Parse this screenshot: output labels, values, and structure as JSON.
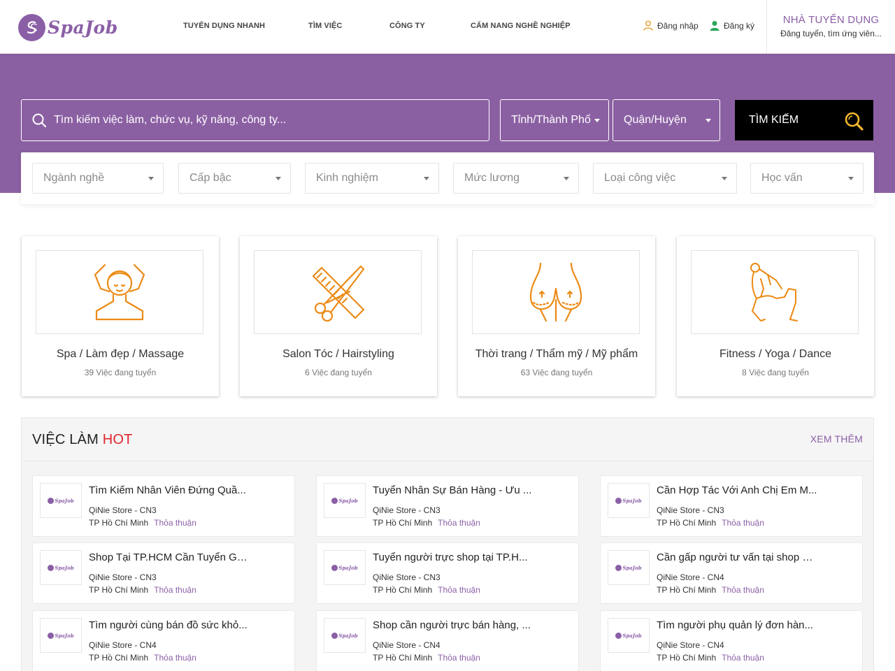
{
  "brand": {
    "name": "SpaJob",
    "accent": "#8b5fa6",
    "hero_bg": "#8b60a3"
  },
  "nav": [
    {
      "label": "TUYỂN DỤNG NHANH"
    },
    {
      "label": "TÌM VIỆC"
    },
    {
      "label": "CÔNG TY"
    },
    {
      "label": "CẨM NANG NGHỀ NGHIỆP"
    }
  ],
  "auth": {
    "login": "Đăng nhập",
    "register": "Đăng ký"
  },
  "employer": {
    "title": "NHÀ TUYỂN DỤNG",
    "subtitle": "Đăng tuyển, tìm ứng viên..."
  },
  "search": {
    "placeholder": "Tìm kiếm việc làm, chức vụ, kỹ năng, công ty...",
    "city": "Tỉnh/Thành Phố",
    "district": "Quận/Huyện",
    "button": "TÌM KIẾM"
  },
  "filters": [
    {
      "label": "Ngành nghề"
    },
    {
      "label": "Cấp bậc"
    },
    {
      "label": "Kinh nghiệm"
    },
    {
      "label": "Mức lương"
    },
    {
      "label": "Loại công việc"
    },
    {
      "label": "Học vấn"
    }
  ],
  "categories": [
    {
      "name": "Spa / Làm đẹp / Massage",
      "count": "39 Việc đang tuyển",
      "icon": "massage-icon"
    },
    {
      "name": "Salon Tóc / Hairstyling",
      "count": "6 Việc đang tuyển",
      "icon": "scissors-comb-icon"
    },
    {
      "name": "Thời trang / Thẩm mỹ / Mỹ phẩm",
      "count": "63 Việc đang tuyển",
      "icon": "body-contour-icon"
    },
    {
      "name": "Fitness / Yoga / Dance",
      "count": "8 Việc đang tuyển",
      "icon": "yoga-icon"
    }
  ],
  "hot": {
    "title_prefix": "VIỆC LÀM",
    "title_highlight": "HOT",
    "more": "XEM THÊM",
    "logo_text": "SpaJob",
    "jobs": [
      {
        "title": "Tìm Kiếm Nhân Viên Đứng Quầ...",
        "company": "QiNie Store - CN3",
        "location": "TP Hồ Chí Minh",
        "salary": "Thỏa thuận"
      },
      {
        "title": "Tuyển Nhân Sự Bán Hàng - Ưu ...",
        "company": "QiNie Store - CN3",
        "location": "TP Hồ Chí Minh",
        "salary": "Thỏa thuận"
      },
      {
        "title": "Cần Hợp Tác Với Anh Chị Em M...",
        "company": "QiNie Store - CN3",
        "location": "TP Hồ Chí Minh",
        "salary": "Thỏa thuận"
      },
      {
        "title": "Shop Tại TP.HCM Cần Tuyển Gấ...",
        "company": "QiNie Store - CN3",
        "location": "TP Hồ Chí Minh",
        "salary": "Thỏa thuận"
      },
      {
        "title": "Tuyển người trực shop tại TP.H...",
        "company": "QiNie Store - CN3",
        "location": "TP Hồ Chí Minh",
        "salary": "Thỏa thuận"
      },
      {
        "title": "Cần gấp người tư vấn tại shop ở...",
        "company": "QiNie Store - CN4",
        "location": "TP Hồ Chí Minh",
        "salary": "Thỏa thuận"
      },
      {
        "title": "Tìm người cùng bán đồ sức khỏ...",
        "company": "QiNie Store - CN4",
        "location": "TP Hồ Chí Minh",
        "salary": "Thỏa thuận"
      },
      {
        "title": "Shop cần người trực bán hàng, ...",
        "company": "QiNie Store - CN4",
        "location": "TP Hồ Chí Minh",
        "salary": "Thỏa thuận"
      },
      {
        "title": "Tìm người phụ quản lý đơn hàn...",
        "company": "QiNie Store - CN4",
        "location": "TP Hồ Chí Minh",
        "salary": "Thỏa thuận"
      }
    ]
  }
}
